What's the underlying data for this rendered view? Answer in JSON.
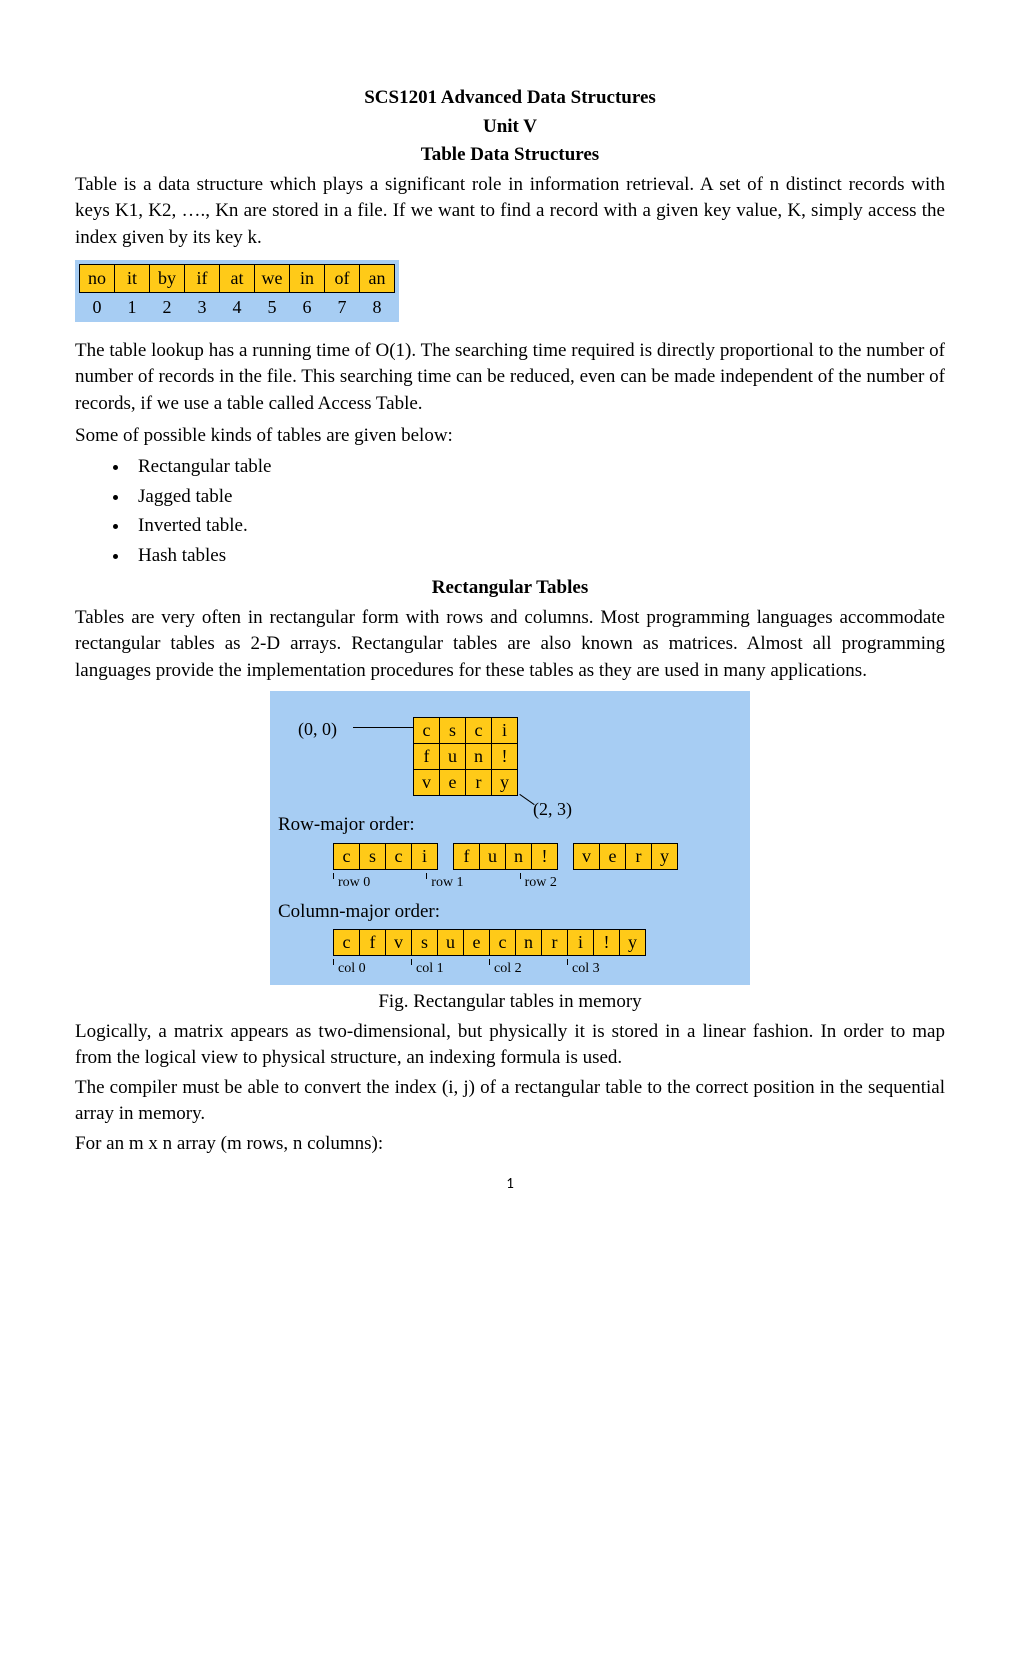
{
  "header": {
    "course": "SCS1201 Advanced Data Structures",
    "unit": "Unit V",
    "title": "Table Data Structures"
  },
  "intro": "Table is a data structure which plays a significant role in information retrieval. A set of n distinct records with keys K1, K2, …., Kn are stored in a file. If we want to find a record with a given key value, K, simply access the index given by its key k.",
  "index_table": {
    "cells": [
      "no",
      "it",
      "by",
      "if",
      "at",
      "we",
      "in",
      "of",
      "an"
    ],
    "indices": [
      "0",
      "1",
      "2",
      "3",
      "4",
      "5",
      "6",
      "7",
      "8"
    ]
  },
  "para2": "The table lookup has a running time of O(1). The searching time required is directly proportional to the number of number of records in the file. This searching time can be reduced, even can be made independent of the number of records, if we use a table called Access Table.",
  "para_kinds_intro": "Some of possible kinds of tables are given below:",
  "kinds": [
    "Rectangular table",
    "Jagged table",
    "Inverted table.",
    "Hash tables"
  ],
  "rect_heading": "Rectangular Tables",
  "rect_para": "Tables are very often in rectangular form with rows and columns. Most programming languages accommodate rectangular tables as 2-D arrays. Rectangular tables are also known as matrices. Almost all programming languages provide the implementation procedures for these tables as they are used in many applications.",
  "chart_data": {
    "type": "table",
    "origin_label": "(0, 0)",
    "corner_label": "(2, 3)",
    "grid": [
      [
        "c",
        "s",
        "c",
        "i"
      ],
      [
        "f",
        "u",
        "n",
        "!"
      ],
      [
        "v",
        "e",
        "r",
        "y"
      ]
    ],
    "row_major_label": "Row-major order:",
    "row_major": [
      "c",
      "s",
      "c",
      "i",
      "f",
      "u",
      "n",
      "!",
      "v",
      "e",
      "r",
      "y"
    ],
    "row_major_groups": [
      "row 0",
      "row 1",
      "row 2"
    ],
    "col_major_label": "Column-major order:",
    "col_major": [
      "c",
      "f",
      "v",
      "s",
      "u",
      "e",
      "c",
      "n",
      "r",
      "i",
      "!",
      "y"
    ],
    "col_major_groups": [
      "col 0",
      "col 1",
      "col 2",
      "col 3"
    ]
  },
  "caption": "Fig. Rectangular tables in memory",
  "para3": "Logically, a matrix appears as two-dimensional, but physically it is stored in a linear fashion. In order to map from the logical view to physical structure, an indexing formula is used.",
  "para4": "The compiler must be able to convert the index (i, j) of a rectangular table to the correct position in the sequential array in memory.",
  "para5": "For an m x n array (m rows, n columns):",
  "page_number": "1"
}
